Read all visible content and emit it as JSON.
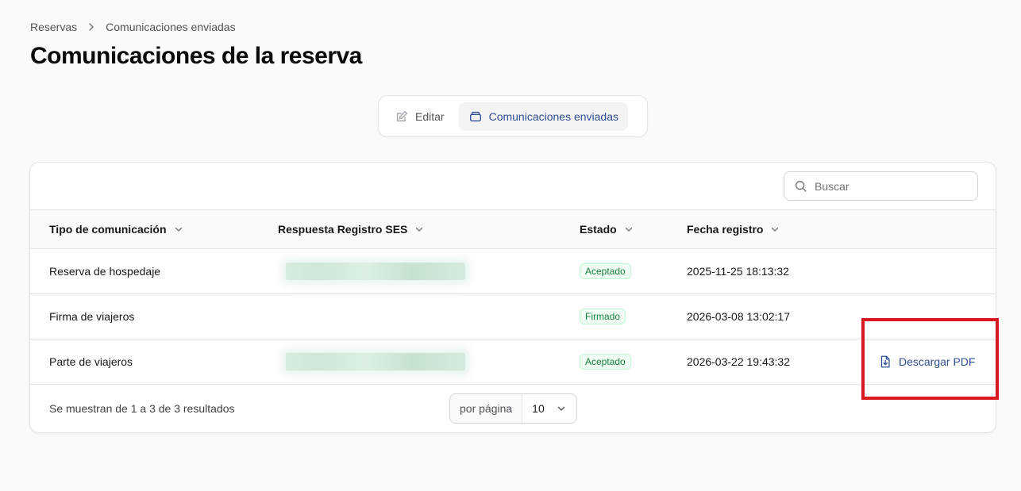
{
  "breadcrumb": {
    "items": [
      "Reservas",
      "Comunicaciones enviadas"
    ]
  },
  "page": {
    "title": "Comunicaciones de la reserva"
  },
  "tabs": [
    {
      "label": "Editar",
      "icon": "pencil-square-icon",
      "active": false
    },
    {
      "label": "Comunicaciones enviadas",
      "icon": "inbox-stack-icon",
      "active": true
    }
  ],
  "search": {
    "placeholder": "Buscar",
    "value": ""
  },
  "table": {
    "columns": [
      "Tipo de comunicación",
      "Respuesta Registro SES",
      "Estado",
      "Fecha registro"
    ],
    "rows": [
      {
        "tipo": "Reserva de hospedaje",
        "respuesta_redacted": true,
        "estado": "Aceptado",
        "fecha": "2025-11-25 18:13:32",
        "action": ""
      },
      {
        "tipo": "Firma de viajeros",
        "respuesta_redacted": false,
        "estado": "Firmado",
        "fecha": "2026-03-08 13:02:17",
        "action": ""
      },
      {
        "tipo": "Parte de viajeros",
        "respuesta_redacted": true,
        "estado": "Aceptado",
        "fecha": "2026-03-22 19:43:32",
        "action": "Descargar PDF"
      }
    ]
  },
  "footer": {
    "results_text": "Se muestran de 1 a 3 de 3 resultados",
    "per_page_label": "por página",
    "per_page_value": "10"
  },
  "colors": {
    "accent": "#2f4f95",
    "success": "#15803d",
    "highlight": "#d9181f"
  }
}
